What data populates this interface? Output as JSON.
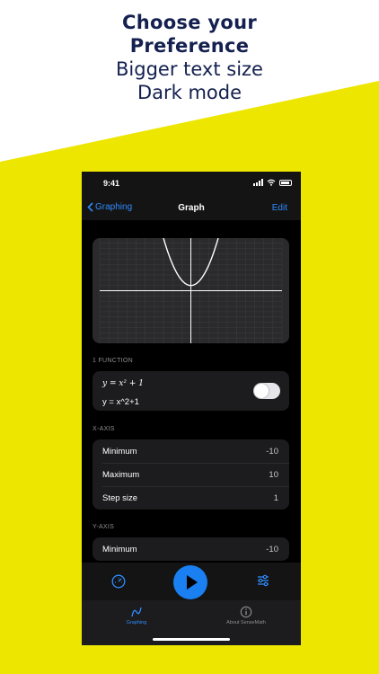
{
  "promo": {
    "headline_line1": "Choose your",
    "headline_line2": "Preference",
    "subline1": "Bigger text size",
    "subline2": "Dark mode",
    "accent_color": "#ede600",
    "text_color": "#14204f"
  },
  "status_bar": {
    "time": "9:41"
  },
  "nav": {
    "back_label": "Graphing",
    "title": "Graph",
    "edit_label": "Edit"
  },
  "function_section": {
    "header": "1 FUNCTION",
    "math_display": "y = x² + 1",
    "text_expression": "y = x^2+1",
    "enabled": true
  },
  "x_axis": {
    "header": "X-AXIS",
    "rows": [
      {
        "label": "Minimum",
        "value": "-10"
      },
      {
        "label": "Maximum",
        "value": "10"
      },
      {
        "label": "Step size",
        "value": "1"
      }
    ]
  },
  "y_axis": {
    "header": "Y-AXIS",
    "rows": [
      {
        "label": "Minimum",
        "value": "-10"
      }
    ]
  },
  "toolbar": {
    "left_icon": "speedometer-icon",
    "center_icon": "play-icon",
    "right_icon": "sliders-icon"
  },
  "tabs": [
    {
      "label": "Graphing",
      "icon": "graphing-icon",
      "active": true
    },
    {
      "label": "About SenseMath",
      "icon": "info-icon",
      "active": false
    }
  ]
}
